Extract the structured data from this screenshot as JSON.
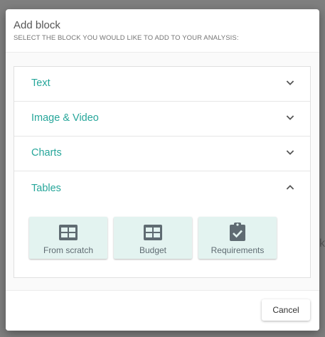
{
  "dialog": {
    "title": "Add block",
    "subtitle": "SELECT THE BLOCK YOU WOULD LIKE TO ADD TO YOUR ANALYSIS:"
  },
  "accordion": {
    "sections": [
      {
        "label": "Text",
        "state": "collapsed",
        "icon": "chevron-down-icon"
      },
      {
        "label": "Image & Video",
        "state": "collapsed",
        "icon": "chevron-down-icon"
      },
      {
        "label": "Charts",
        "state": "collapsed",
        "icon": "chevron-down-icon"
      },
      {
        "label": "Tables",
        "state": "expanded",
        "icon": "chevron-up-icon"
      }
    ],
    "tables_tiles": [
      {
        "label": "From scratch",
        "icon": "table-icon"
      },
      {
        "label": "Budget",
        "icon": "table-icon"
      },
      {
        "label": "Requirements",
        "icon": "clipboard-check-icon"
      }
    ]
  },
  "footer": {
    "cancel_label": "Cancel"
  },
  "background": {
    "partial_text": "k"
  },
  "colors": {
    "accent": "#26a69a",
    "tile_bg": "#e3f3f0",
    "icon": "#5f6b72"
  }
}
